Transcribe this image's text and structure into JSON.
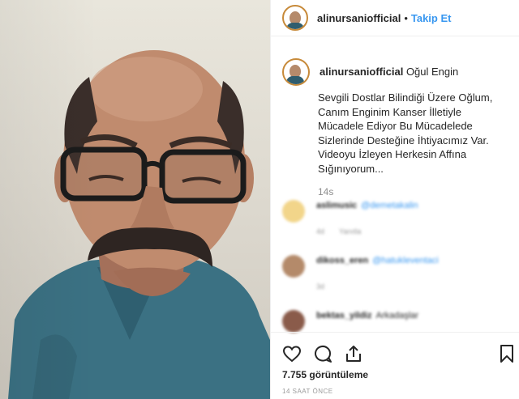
{
  "header": {
    "username": "alinursaniofficial",
    "separator": "•",
    "follow_label": "Takip Et"
  },
  "caption": {
    "username": "alinursaniofficial",
    "title": "Oğul Engin",
    "text": "Sevgili Dostlar Bilindiği Üzere Oğlum,\nCanım Enginim Kanser İlletiyle\nMücadele Ediyor Bu Mücadelede\nSizlerinde Desteğine İhtiyacımız Var.\nVideoyu İzleyen Herkesin Affına\nSığınıyorum...",
    "time": "14s"
  },
  "comments": [
    {
      "username": "aslimusic",
      "mention": "@demetakalin",
      "age": "4d",
      "reply": "Yanıtla"
    },
    {
      "username": "dikoss_eren",
      "mention": "@hatukleventaci",
      "age": "3d",
      "reply": ""
    },
    {
      "username": "bektas_yildiz",
      "mention": "Arkadaşlar",
      "age": "",
      "reply": ""
    }
  ],
  "stats": {
    "views": "7.755 görüntüleme",
    "time_ago": "14 SAAT ÖNCE"
  },
  "icons": [
    "heart-icon",
    "comment-icon",
    "share-icon",
    "bookmark-icon"
  ],
  "colors": {
    "link": "#3897f0",
    "text": "#262626",
    "muted": "#8e8e8e"
  }
}
